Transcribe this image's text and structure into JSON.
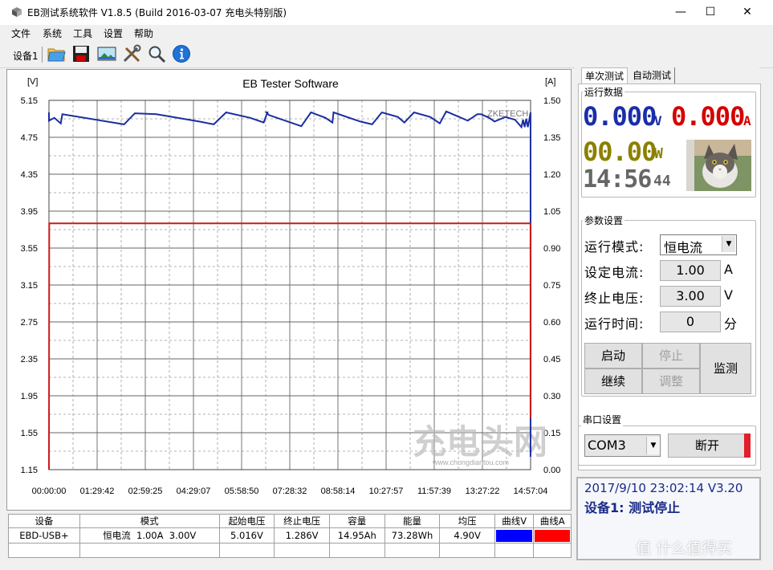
{
  "window": {
    "title": "EB测试系统软件 V1.8.5 (Build 2016-03-07 充电头特别版)",
    "minimize": "—",
    "maximize": "☐",
    "close": "✕"
  },
  "menu": [
    "文件",
    "系统",
    "工具",
    "设置",
    "帮助"
  ],
  "toolbar": {
    "device_label": "设备1",
    "icons": [
      "folder-icon",
      "save-icon",
      "image-icon",
      "tools-icon",
      "search-icon",
      "info-icon"
    ]
  },
  "chart_data": {
    "type": "line",
    "title": "EB Tester Software",
    "watermark": "ZKETECH",
    "brand_watermark": "充电头网",
    "brand_url": "www.chongdiantou.com",
    "left_unit": "[V]",
    "right_unit": "[A]",
    "yticks_left": [
      "5.15",
      "4.75",
      "4.35",
      "3.95",
      "3.55",
      "3.15",
      "2.75",
      "2.35",
      "1.95",
      "1.55",
      "1.15"
    ],
    "yticks_right": [
      "1.50",
      "1.35",
      "1.20",
      "1.05",
      "0.90",
      "0.75",
      "0.60",
      "0.45",
      "0.30",
      "0.15",
      "0.00"
    ],
    "xticks": [
      "00:00:00",
      "01:29:42",
      "02:59:25",
      "04:29:07",
      "05:58:50",
      "07:28:32",
      "08:58:14",
      "10:27:57",
      "11:57:39",
      "13:27:22",
      "14:57:04"
    ],
    "ylim_left": [
      1.15,
      5.15
    ],
    "ylim_right": [
      0,
      1.5
    ],
    "xlim_min": [
      0,
      897.07
    ],
    "series": [
      {
        "name": "曲线V",
        "axis": "left",
        "color": "#1a2ea0",
        "x_min": [
          0,
          0,
          10,
          22,
          25,
          140,
          160,
          200,
          280,
          307,
          330,
          375,
          400,
          407,
          405,
          410,
          470,
          488,
          515,
          528,
          530,
          580,
          602,
          620,
          650,
          662,
          680,
          710,
          728,
          740,
          780,
          798,
          805,
          820,
          830,
          850,
          868,
          880,
          883,
          886,
          889,
          892,
          895,
          897
        ],
        "v": [
          5.02,
          4.93,
          4.96,
          4.9,
          5.0,
          4.89,
          5.01,
          5.0,
          4.92,
          4.89,
          5.02,
          4.96,
          4.91,
          5.02,
          5.02,
          4.99,
          4.87,
          5.02,
          4.96,
          4.91,
          5.02,
          4.92,
          4.89,
          5.02,
          4.97,
          4.91,
          5.02,
          4.97,
          4.9,
          5.03,
          4.93,
          5.0,
          5.0,
          4.96,
          4.92,
          4.97,
          4.94,
          4.86,
          4.94,
          4.86,
          4.95,
          4.86,
          4.95,
          5.02
        ]
      },
      {
        "name": "曲线A",
        "axis": "right",
        "color": "#cc1a1a",
        "x_min": [
          0,
          0.5,
          897
        ],
        "a": [
          0,
          1.0,
          1.0
        ]
      }
    ],
    "grid": true
  },
  "table": {
    "headers": [
      "设备",
      "模式",
      "起始电压",
      "终止电压",
      "容量",
      "能量",
      "均压",
      "曲线V",
      "曲线A"
    ],
    "row": [
      "EBD-USB+",
      "恒电流  1.00A  3.00V",
      "5.016V",
      "1.286V",
      "14.95Ah",
      "73.28Wh",
      "4.90V",
      "",
      ""
    ],
    "color_v": "#0000ff",
    "color_a": "#ff0000"
  },
  "right": {
    "tabs": [
      "单次测试",
      "自动测试"
    ],
    "run_data_title": "运行数据",
    "voltage": "0.000",
    "voltage_unit": "V",
    "current": "0.000",
    "current_unit": "A",
    "power": "00.00",
    "power_unit": "W",
    "clock": "14:56",
    "clock_seconds": "44",
    "voltage_color": "#1a2ea8",
    "current_color": "#d40000",
    "power_color": "#8b8000",
    "params_title": "参数设置",
    "mode_label": "运行模式:",
    "mode_value": "恒电流",
    "current_label": "设定电流:",
    "current_value": "1.00",
    "current_set_unit": "A",
    "cutoff_label": "终止电压:",
    "cutoff_value": "3.00",
    "cutoff_unit": "V",
    "time_label": "运行时间:",
    "time_value": "0",
    "time_unit": "分",
    "btn_start": "启动",
    "btn_stop": "停止",
    "btn_continue": "继续",
    "btn_adjust": "调整",
    "btn_monitor": "监测",
    "serial_title": "串口设置",
    "port": "COM3",
    "btn_disconnect": "断开",
    "status_line1": "2017/9/10 23:02:14  V3.20",
    "status_line2": "设备1: 测试停止"
  },
  "site_watermark": "值 什么值得买"
}
